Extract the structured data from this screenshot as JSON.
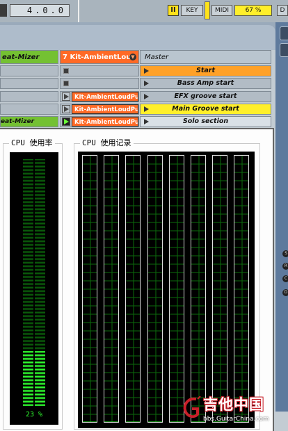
{
  "live": {
    "tempo_display": "4.0.0",
    "pause_label": "II",
    "key_label": "KEY",
    "midi_label": "MIDI",
    "cpu_load_label": "67 %",
    "d_label": "D",
    "tracks": {
      "col1_name": "eat-Mizer",
      "col2_name": "7 Kit-AmbientLou",
      "col3_name": "Master"
    },
    "rows": [
      {
        "col1": "",
        "col2_clip": "",
        "col2_state": "stop",
        "scene": "Start",
        "scene_style": "orange"
      },
      {
        "col1": "",
        "col2_clip": "",
        "col2_state": "stop",
        "scene": "Bass Amp start",
        "scene_style": "plain"
      },
      {
        "col1": "",
        "col2_clip": "Kit-AmbientLoudPu",
        "col2_state": "play",
        "scene": "EFX groove start",
        "scene_style": "plain"
      },
      {
        "col1": "",
        "col2_clip": "Kit-AmbientLoudPu",
        "col2_state": "play",
        "scene": "Main Groove start",
        "scene_style": "yellow"
      },
      {
        "col1": "eat-Mizer",
        "col2_clip": "Kit-AmbientLoudPu",
        "col2_state": "playing",
        "scene": "Solo section",
        "scene_style": "light"
      }
    ],
    "side_dots": [
      "S",
      "R",
      "C",
      "D"
    ]
  },
  "cpu_window": {
    "usage_title": "CPU 使用率",
    "usage_value_label": "23 %",
    "usage_fraction": 0.23,
    "history_title": "CPU 使用记录",
    "history_series": [
      [
        0,
        0,
        0,
        0,
        0,
        0,
        0,
        0,
        0,
        0,
        0,
        0,
        0,
        0,
        0,
        0,
        0,
        0,
        0,
        0,
        0,
        0,
        0,
        0,
        0,
        0,
        0,
        0,
        0,
        0,
        0,
        0,
        0,
        0,
        0,
        0,
        0,
        0,
        0,
        0,
        0,
        0,
        0,
        0,
        0,
        0,
        0,
        0,
        0,
        0,
        0,
        0,
        0,
        0,
        0,
        0,
        0,
        0,
        0,
        0,
        0,
        0,
        0,
        0,
        0,
        0,
        0,
        0,
        0,
        0,
        0,
        0,
        0,
        0,
        0,
        0,
        0,
        0,
        0,
        0,
        0,
        0,
        0,
        0,
        0,
        0,
        0,
        0,
        0,
        0,
        0,
        0,
        0,
        0,
        0,
        0,
        0,
        0,
        0,
        0
      ],
      [
        0,
        0,
        0,
        0,
        0,
        0,
        0,
        0,
        0,
        0,
        0,
        0,
        0,
        0,
        0,
        0,
        0,
        0,
        0,
        0,
        0,
        0,
        0,
        0,
        0,
        0,
        0,
        0,
        0,
        0,
        0,
        0,
        0,
        0,
        0,
        0,
        0,
        0,
        0,
        0,
        0,
        0,
        0,
        0,
        0,
        0,
        0,
        0,
        0,
        0,
        0,
        0,
        0,
        0,
        0,
        0,
        0,
        0,
        0,
        0,
        0,
        0,
        0,
        0,
        0,
        0,
        0,
        0,
        0,
        0,
        0,
        0,
        0,
        0,
        0,
        0,
        0,
        0,
        0,
        0,
        0,
        0,
        0,
        0,
        0,
        0,
        0,
        0,
        0,
        0,
        0,
        0,
        0,
        0,
        0,
        0,
        0,
        0,
        0,
        0
      ],
      [
        0,
        0,
        0,
        0,
        0,
        0,
        0,
        0,
        0,
        0,
        0,
        0,
        0,
        0,
        0,
        0,
        0,
        0,
        0,
        0,
        0,
        0,
        0,
        0,
        0,
        0,
        0,
        0,
        0,
        0,
        0,
        0,
        0,
        0,
        0,
        0,
        0,
        0,
        0,
        0,
        0,
        0,
        0,
        0,
        0,
        0,
        0,
        0,
        0,
        0,
        0,
        0,
        0,
        0,
        0,
        0,
        0,
        0,
        0,
        0,
        0,
        0,
        0,
        0,
        0,
        0,
        0,
        0,
        0,
        0,
        0,
        0,
        0,
        0,
        0,
        0,
        0,
        0,
        0,
        0,
        0,
        0,
        0,
        0,
        0,
        0,
        0,
        0,
        0,
        0,
        0,
        0,
        0,
        0,
        0,
        0,
        0,
        0,
        0,
        0
      ],
      [
        0,
        0,
        0,
        0,
        0,
        0,
        0,
        0,
        0,
        0,
        0,
        0,
        0,
        0,
        0,
        0,
        0,
        0,
        0,
        0,
        0,
        0,
        0,
        0,
        0,
        0,
        0,
        0,
        0,
        0,
        0,
        0,
        0,
        0,
        0,
        0,
        0,
        0,
        0,
        0,
        0,
        0,
        0,
        0,
        0,
        0,
        0,
        0,
        0,
        0,
        0,
        0,
        0,
        0,
        0,
        0,
        0,
        0,
        0,
        0,
        0,
        0,
        0,
        0,
        0,
        0,
        0,
        0,
        0,
        0,
        0,
        0,
        0,
        0,
        0,
        0,
        0,
        0,
        0,
        0,
        0,
        0,
        0,
        0,
        0,
        0,
        0,
        0,
        0,
        0,
        0,
        0,
        0,
        0,
        0,
        0,
        0,
        0,
        0,
        0
      ],
      [
        0,
        0,
        0,
        0,
        0,
        0,
        0,
        0,
        0,
        0,
        0,
        0,
        0,
        0,
        0,
        0,
        0,
        0,
        0,
        0,
        0,
        0,
        0,
        0,
        0,
        0,
        0,
        0,
        0,
        0,
        0,
        0,
        0,
        0,
        0,
        0,
        0,
        0,
        0,
        0,
        0,
        0,
        0,
        0,
        0,
        0,
        0,
        0,
        0,
        0,
        0,
        0,
        0,
        0,
        0,
        0,
        0,
        0,
        0,
        0,
        0,
        0,
        0,
        0,
        0,
        0,
        0,
        0,
        0,
        0,
        0,
        0,
        0,
        0,
        0,
        0,
        0,
        0,
        0,
        0,
        0,
        0,
        0,
        0,
        0,
        0,
        0,
        0,
        0,
        0,
        0,
        0,
        0,
        0,
        0,
        0,
        0,
        0,
        0,
        0
      ],
      [
        0,
        0,
        0,
        0,
        0,
        0,
        0,
        0,
        0,
        0,
        0,
        0,
        0,
        0,
        0,
        0,
        0,
        0,
        0,
        0,
        0,
        0,
        0,
        0,
        0,
        0,
        0,
        0,
        0,
        0,
        0,
        0,
        0,
        0,
        0,
        0,
        0,
        0,
        0,
        0,
        0,
        0,
        0,
        0,
        0,
        0,
        0,
        0,
        0,
        0,
        0,
        0,
        0,
        0,
        0,
        0,
        0,
        0,
        0,
        0,
        0,
        0,
        0,
        0,
        0,
        0,
        0,
        0,
        0,
        0,
        0,
        0,
        0,
        0,
        0,
        0,
        0,
        0,
        0,
        0,
        0,
        0,
        0,
        0,
        0,
        0,
        0,
        0,
        0,
        0,
        0,
        0,
        0,
        0,
        0,
        0,
        0,
        0,
        0,
        0
      ],
      [
        0,
        0,
        0,
        0,
        0,
        0,
        0,
        0,
        0,
        0,
        0,
        0,
        0,
        0,
        0,
        0,
        0,
        0,
        0,
        0,
        0,
        0,
        0,
        0,
        0,
        0,
        0,
        0,
        0,
        0,
        0,
        0,
        0,
        0,
        0,
        0,
        0,
        0,
        0,
        0,
        0,
        0,
        0,
        0,
        0,
        0,
        0,
        0,
        0,
        0,
        0,
        0,
        0,
        0,
        0,
        0,
        0,
        0,
        0,
        0,
        0,
        0,
        0,
        0,
        0,
        0,
        0,
        0,
        0,
        0,
        0,
        0,
        0,
        0,
        0,
        0,
        0,
        0,
        0,
        0,
        0,
        0,
        0,
        0,
        0,
        0,
        0,
        0,
        0,
        0,
        0,
        0,
        0,
        0,
        0,
        0,
        0,
        0,
        0,
        0
      ],
      [
        0,
        0,
        0,
        0,
        0,
        0,
        0,
        0,
        0,
        0,
        0,
        0,
        0,
        0,
        0,
        0,
        0,
        0,
        0,
        0,
        0,
        0,
        0,
        0,
        0,
        0,
        0,
        0,
        0,
        0,
        0,
        0,
        0,
        0,
        0,
        0,
        0,
        0,
        0,
        0,
        0,
        0,
        0,
        0,
        0,
        0,
        0,
        0,
        0,
        0,
        0,
        0,
        0,
        0,
        0,
        0,
        0,
        0,
        0,
        0,
        0,
        0,
        0,
        0,
        0,
        0,
        0,
        0,
        0,
        0,
        0,
        0,
        0,
        0,
        0,
        0,
        0,
        0,
        0,
        0,
        0,
        0,
        0,
        0,
        0,
        0,
        0,
        0,
        0,
        0,
        0,
        0,
        0,
        0,
        0,
        0,
        0,
        0,
        0,
        0
      ]
    ]
  },
  "watermark": {
    "site_name": "吉他中国",
    "url": "bbs.GuitarChina.com"
  },
  "colors": {
    "meter_green": "#2fff2f",
    "grid_green": "#0c6b0c",
    "clip_orange": "#ff6a26",
    "scene_yellow": "#ffef2b",
    "scene_orange": "#ffa128",
    "track_green": "#74c132"
  }
}
